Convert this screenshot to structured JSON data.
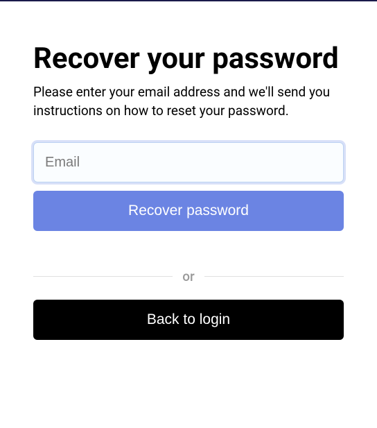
{
  "title": "Recover your password",
  "subtitle": "Please enter your email address and we'll send you instructions on how to reset your password.",
  "email": {
    "placeholder": "Email",
    "value": ""
  },
  "recover_button": "Recover password",
  "divider": "or",
  "back_button": "Back to login"
}
